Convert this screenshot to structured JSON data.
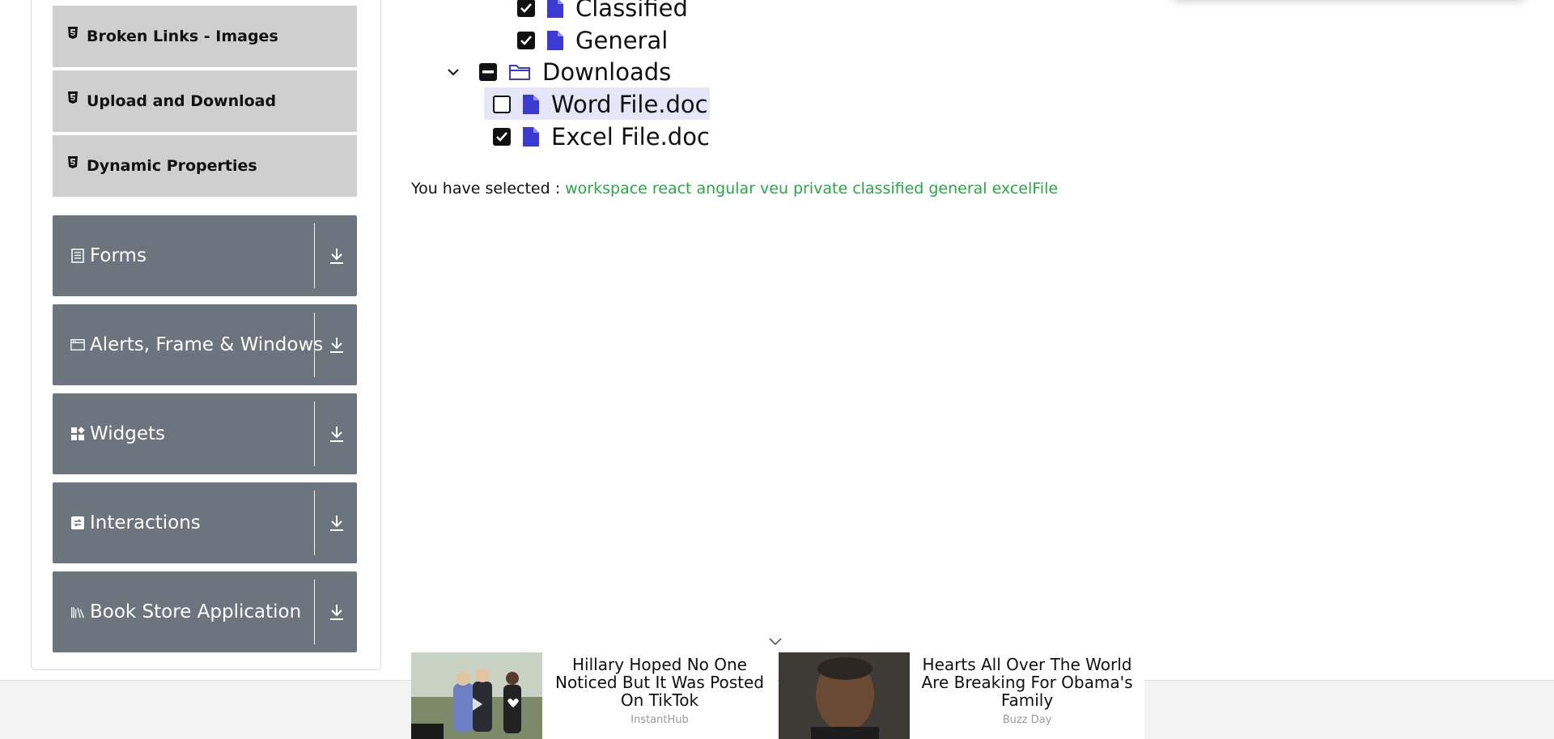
{
  "sidebar": {
    "sub_items": [
      {
        "label": "Broken Links - Images",
        "icon": "html5-icon"
      },
      {
        "label": "Upload and Download",
        "icon": "html5-icon"
      },
      {
        "label": "Dynamic Properties",
        "icon": "html5-icon"
      }
    ],
    "groups": [
      {
        "label": "Forms",
        "icon": "form-icon"
      },
      {
        "label": "Alerts, Frame & Windows",
        "icon": "window-icon"
      },
      {
        "label": "Widgets",
        "icon": "widgets-icon"
      },
      {
        "label": "Interactions",
        "icon": "interactions-icon"
      },
      {
        "label": "Book Store Application",
        "icon": "books-icon"
      }
    ]
  },
  "tree": {
    "classified": "Classified",
    "general": "General",
    "downloads": "Downloads",
    "word": "Word File.doc",
    "excel": "Excel File.doc"
  },
  "result": {
    "prefix": "You have selected :",
    "values": [
      "workspace",
      "react",
      "angular",
      "veu",
      "private",
      "classified",
      "general",
      "excelFile"
    ]
  },
  "ads": [
    {
      "title": "Hillary Hoped No One Noticed But It Was Posted On TikTok",
      "source": "InstantHub"
    },
    {
      "title": "Hearts All Over The World Are Breaking For Obama's Family",
      "source": "Buzz Day"
    }
  ],
  "colors": {
    "menu_group_bg": "#6c757d",
    "menu_item_bg": "#cfcfcf",
    "selected_green": "#28a745",
    "file_icon_blue": "#3b3bd4"
  }
}
